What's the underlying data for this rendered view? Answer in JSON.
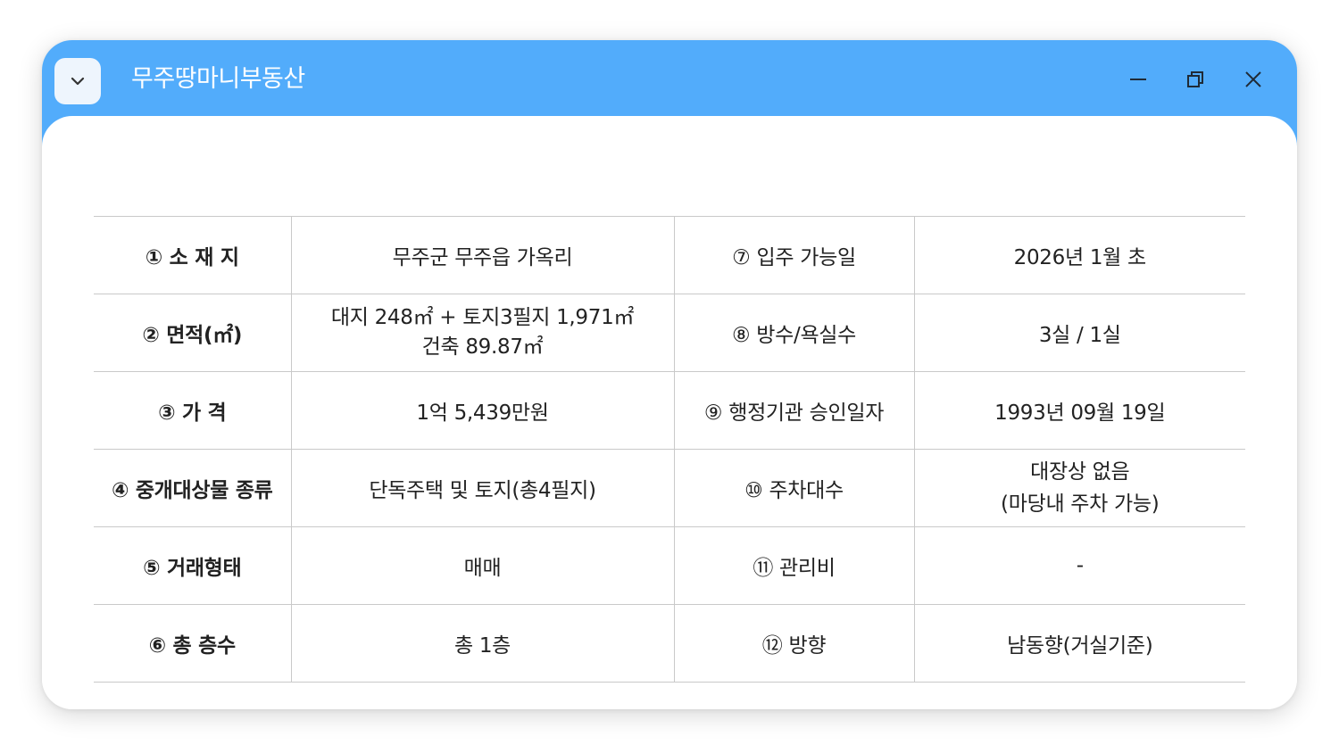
{
  "window": {
    "title": "무주땅마니부동산",
    "menu_icon": "chevron-down-icon",
    "controls": [
      "minimize-icon",
      "restore-icon",
      "close-icon"
    ],
    "accent_color": "#52acfb"
  },
  "table": {
    "rows": [
      {
        "label_left": "① 소 재 지",
        "value_left": "무주군 무주읍 가옥리",
        "label_right": "⑦ 입주 가능일",
        "value_right": "2026년 1월 초"
      },
      {
        "label_left": "② 면적(㎡)",
        "value_left_line1": "대지 248㎡ + 토지3필지 1,971㎡",
        "value_left_line2": "건축 89.87㎡",
        "label_right": "⑧ 방수/욕실수",
        "value_right": "3실  / 1실"
      },
      {
        "label_left": "③ 가 격",
        "value_left": "1억 5,439만원",
        "label_right": "⑨ 행정기관 승인일자",
        "value_right": "1993년 09월 19일"
      },
      {
        "label_left": "④ 중개대상물 종류",
        "value_left": "단독주택 및 토지(총4필지)",
        "label_right": "⑩ 주차대수",
        "value_right_line1": "대장상 없음",
        "value_right_line2": "(마당내 주차 가능)"
      },
      {
        "label_left": "⑤ 거래형태",
        "value_left": "매매",
        "label_right": "⑪ 관리비",
        "value_right": "-"
      },
      {
        "label_left": "⑥  총 층수",
        "value_left": "총 1층",
        "label_right": "⑫ 방향",
        "value_right": "남동향(거실기준)"
      }
    ]
  }
}
